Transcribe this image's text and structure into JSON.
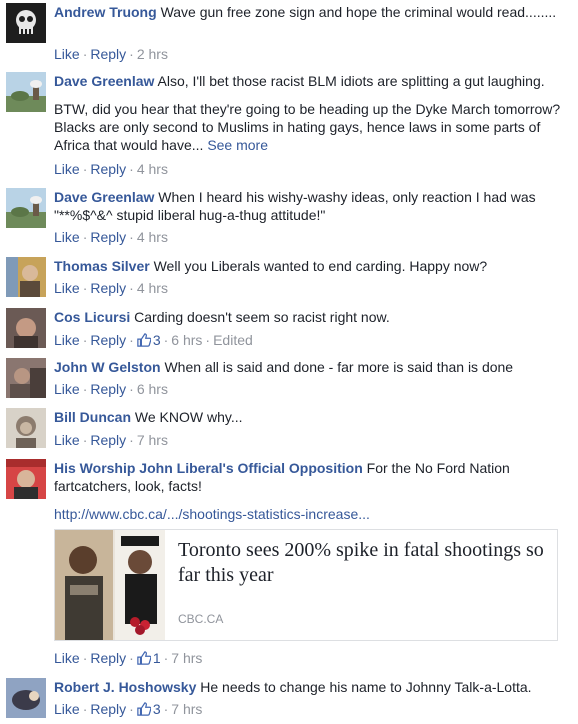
{
  "ui": {
    "like": "Like",
    "reply": "Reply",
    "sep": "·"
  },
  "comments": [
    {
      "author": "Andrew Truong",
      "text": "Wave gun free zone sign and hope the criminal would read........",
      "time": "2 hrs"
    },
    {
      "author": "Dave Greenlaw",
      "text": "Also, I'll bet those racist BLM idiots are splitting a gut laughing.",
      "text2": "BTW, did you hear that they're going to be heading up the Dyke March tomorrow? Blacks are only second to Muslims in hating gays, hence laws in some parts of Africa that would have...",
      "see_more": "See more",
      "time": "4 hrs"
    },
    {
      "author": "Dave Greenlaw",
      "text": "When I heard his wishy-washy ideas, only reaction I had was \"**%$^&^ stupid liberal hug-a-thug attitude!\"",
      "time": "4 hrs"
    },
    {
      "author": "Thomas Silver",
      "text": "Well you Liberals wanted to end carding. Happy now?",
      "time": "4 hrs"
    },
    {
      "author": "Cos Licursi",
      "text": "Carding doesn't seem so racist right now.",
      "likes": "3",
      "time": "6 hrs",
      "edited": "Edited"
    },
    {
      "author": "John W Gelston",
      "text": "When all is said and done - far more is said than is done",
      "time": "6 hrs"
    },
    {
      "author": "Bill Duncan",
      "text": "We KNOW why...",
      "time": "7 hrs"
    },
    {
      "author": "His Worship John Liberal's Official Opposition",
      "text": "For the No Ford Nation fartcatchers, look, facts!",
      "url": "http://www.cbc.ca/.../shootings-statistics-increase...",
      "card_title": "Toronto sees 200% spike in fatal shootings so far this year",
      "card_source": "CBC.CA",
      "likes": "1",
      "time": "7 hrs"
    },
    {
      "author": "Robert J. Hoshowsky",
      "text": "He needs to change his name to Johnny Talk-a-Lotta.",
      "likes": "3",
      "time": "7 hrs"
    }
  ]
}
